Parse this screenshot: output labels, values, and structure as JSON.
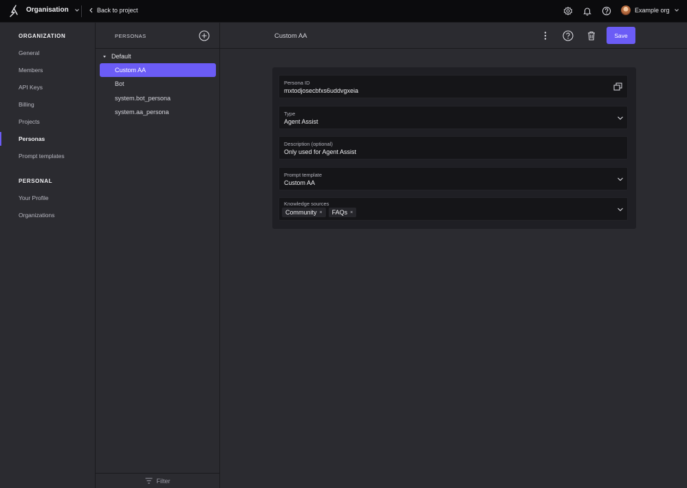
{
  "topbar": {
    "org_switch_label": "Organisation",
    "back_label": "Back to project",
    "account_label": "Example org"
  },
  "leftnav": {
    "org_section": "ORGANIZATION",
    "org_items": [
      {
        "label": "General"
      },
      {
        "label": "Members"
      },
      {
        "label": "API Keys"
      },
      {
        "label": "Billing"
      },
      {
        "label": "Projects"
      },
      {
        "label": "Personas",
        "active": true
      },
      {
        "label": "Prompt templates"
      }
    ],
    "personal_section": "PERSONAL",
    "personal_items": [
      {
        "label": "Your Profile"
      },
      {
        "label": "Organizations"
      }
    ]
  },
  "personas_panel": {
    "title": "PERSONAS",
    "group_label": "Default",
    "items": [
      {
        "label": "Custom AA",
        "selected": true
      },
      {
        "label": "Bot"
      },
      {
        "label": "system.bot_persona"
      },
      {
        "label": "system.aa_persona"
      }
    ],
    "filter_label": "Filter"
  },
  "main": {
    "title": "Custom AA",
    "save_label": "Save",
    "fields": {
      "persona_id": {
        "label": "Persona ID",
        "value": "mxtodjosecbfxs6uddvgxeia"
      },
      "type": {
        "label": "Type",
        "value": "Agent Assist"
      },
      "description": {
        "label": "Description (optional)",
        "value": "Only used for Agent Assist"
      },
      "prompt_template": {
        "label": "Prompt template",
        "value": "Custom AA"
      },
      "knowledge_sources": {
        "label": "Knowledge sources",
        "chips": [
          "Community",
          "FAQs"
        ],
        "remove_glyph": "×"
      }
    }
  },
  "colors": {
    "accent": "#6b5cf6",
    "topbar_bg": "#0b0b0d",
    "panel_bg": "#2b2b30",
    "card_bg": "#1f1f24",
    "field_bg": "#151518"
  }
}
